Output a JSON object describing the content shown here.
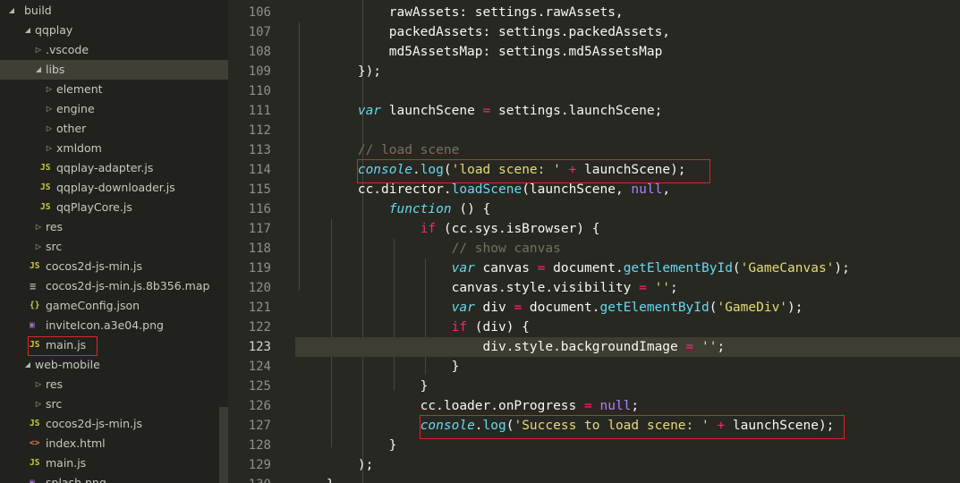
{
  "sidebar": {
    "items": [
      {
        "label": "build",
        "icon": "chevron-down",
        "type": "folder-open"
      },
      {
        "label": "qqplay",
        "icon": "chevron-down",
        "type": "folder-open"
      },
      {
        "label": ".vscode",
        "icon": "chevron-right",
        "type": "folder"
      },
      {
        "label": "libs",
        "icon": "chevron-down",
        "type": "folder-open"
      },
      {
        "label": "element",
        "icon": "chevron-right",
        "type": "folder"
      },
      {
        "label": "engine",
        "icon": "chevron-right",
        "type": "folder"
      },
      {
        "label": "other",
        "icon": "chevron-right",
        "type": "folder"
      },
      {
        "label": "xmldom",
        "icon": "chevron-right",
        "type": "folder"
      },
      {
        "label": "qqplay-adapter.js",
        "icon": "JS",
        "type": "js"
      },
      {
        "label": "qqplay-downloader.js",
        "icon": "JS",
        "type": "js"
      },
      {
        "label": "qqPlayCore.js",
        "icon": "JS",
        "type": "js"
      },
      {
        "label": "res",
        "icon": "chevron-right",
        "type": "folder"
      },
      {
        "label": "src",
        "icon": "chevron-right",
        "type": "folder"
      },
      {
        "label": "cocos2d-js-min.js",
        "icon": "JS",
        "type": "js"
      },
      {
        "label": "cocos2d-js-min.js.8b356.map",
        "icon": "≡",
        "type": "map"
      },
      {
        "label": "gameConfig.json",
        "icon": "{}",
        "type": "json"
      },
      {
        "label": "inviteIcon.a3e04.png",
        "icon": "▣",
        "type": "image"
      },
      {
        "label": "main.js",
        "icon": "JS",
        "type": "js"
      },
      {
        "label": "web-mobile",
        "icon": "chevron-down",
        "type": "folder-open"
      },
      {
        "label": "res",
        "icon": "chevron-right",
        "type": "folder"
      },
      {
        "label": "src",
        "icon": "chevron-right",
        "type": "folder"
      },
      {
        "label": "cocos2d-js-min.js",
        "icon": "JS",
        "type": "js"
      },
      {
        "label": "index.html",
        "icon": "<>",
        "type": "html"
      },
      {
        "label": "main.js",
        "icon": "JS",
        "type": "js"
      },
      {
        "label": "splash.png",
        "icon": "▣",
        "type": "image"
      }
    ]
  },
  "editor": {
    "active_line": 123,
    "lines": [
      {
        "n": "106",
        "code": [
          [
            "",
            "            rawAssets: settings.rawAssets,"
          ]
        ]
      },
      {
        "n": "107",
        "code": [
          [
            "",
            "            packedAssets: settings.packedAssets,"
          ]
        ]
      },
      {
        "n": "108",
        "code": [
          [
            "",
            "            md5AssetsMap: settings.md5AssetsMap"
          ]
        ]
      },
      {
        "n": "109",
        "code": [
          [
            "",
            "        });"
          ]
        ]
      },
      {
        "n": "110",
        "code": []
      },
      {
        "n": "111",
        "code": [
          [
            "",
            "        "
          ],
          [
            "var",
            "var"
          ],
          [
            "",
            " launchScene "
          ],
          [
            "op",
            "="
          ],
          [
            "",
            " settings.launchScene;"
          ]
        ]
      },
      {
        "n": "112",
        "code": []
      },
      {
        "n": "113",
        "code": [
          [
            "",
            "        "
          ],
          [
            "cmt",
            "// load scene"
          ]
        ]
      },
      {
        "n": "114",
        "code": [
          [
            "",
            "        "
          ],
          [
            "var",
            "console"
          ],
          [
            "",
            "."
          ],
          [
            "fn",
            "log"
          ],
          [
            "",
            "("
          ],
          [
            "str",
            "'load scene: '"
          ],
          [
            "",
            " "
          ],
          [
            "op",
            "+"
          ],
          [
            "",
            " launchScene);"
          ]
        ]
      },
      {
        "n": "115",
        "code": [
          [
            "",
            "        cc.director."
          ],
          [
            "fn",
            "loadScene"
          ],
          [
            "",
            "(launchScene, "
          ],
          [
            "null",
            "null"
          ],
          [
            "",
            ","
          ]
        ]
      },
      {
        "n": "116",
        "code": [
          [
            "",
            "            "
          ],
          [
            "func",
            "function"
          ],
          [
            "",
            " () {"
          ]
        ]
      },
      {
        "n": "117",
        "code": [
          [
            "",
            "                "
          ],
          [
            "kw",
            "if"
          ],
          [
            "",
            " (cc.sys.isBrowser) {"
          ]
        ]
      },
      {
        "n": "118",
        "code": [
          [
            "",
            "                    "
          ],
          [
            "cmt",
            "// show canvas"
          ]
        ]
      },
      {
        "n": "119",
        "code": [
          [
            "",
            "                    "
          ],
          [
            "var",
            "var"
          ],
          [
            "",
            " canvas "
          ],
          [
            "op",
            "="
          ],
          [
            "",
            " document."
          ],
          [
            "fn",
            "getElementById"
          ],
          [
            "",
            "("
          ],
          [
            "str",
            "'GameCanvas'"
          ],
          [
            "",
            ");"
          ]
        ]
      },
      {
        "n": "120",
        "code": [
          [
            "",
            "                    canvas.style.visibility "
          ],
          [
            "op",
            "="
          ],
          [
            "",
            " "
          ],
          [
            "str",
            "''"
          ],
          [
            "",
            ";"
          ]
        ]
      },
      {
        "n": "121",
        "code": [
          [
            "",
            "                    "
          ],
          [
            "var",
            "var"
          ],
          [
            "",
            " div "
          ],
          [
            "op",
            "="
          ],
          [
            "",
            " document."
          ],
          [
            "fn",
            "getElementById"
          ],
          [
            "",
            "("
          ],
          [
            "str",
            "'GameDiv'"
          ],
          [
            "",
            ");"
          ]
        ]
      },
      {
        "n": "122",
        "code": [
          [
            "",
            "                    "
          ],
          [
            "kw",
            "if"
          ],
          [
            "",
            " (div) {"
          ]
        ]
      },
      {
        "n": "123",
        "code": [
          [
            "",
            "                        div.style.backgroundImage "
          ],
          [
            "op",
            "="
          ],
          [
            "",
            " "
          ],
          [
            "str",
            "''"
          ],
          [
            "",
            ";"
          ]
        ]
      },
      {
        "n": "124",
        "code": [
          [
            "",
            "                    }"
          ]
        ]
      },
      {
        "n": "125",
        "code": [
          [
            "",
            "                }"
          ]
        ]
      },
      {
        "n": "126",
        "code": [
          [
            "",
            "                cc.loader.onProgress "
          ],
          [
            "op",
            "="
          ],
          [
            "",
            " "
          ],
          [
            "null",
            "null"
          ],
          [
            "",
            ";"
          ]
        ]
      },
      {
        "n": "127",
        "code": [
          [
            "",
            "                "
          ],
          [
            "var",
            "console"
          ],
          [
            "",
            "."
          ],
          [
            "fn",
            "log"
          ],
          [
            "",
            "("
          ],
          [
            "str",
            "'Success to load scene: '"
          ],
          [
            "",
            " "
          ],
          [
            "op",
            "+"
          ],
          [
            "",
            " launchScene);"
          ]
        ]
      },
      {
        "n": "128",
        "code": [
          [
            "",
            "            }"
          ]
        ]
      },
      {
        "n": "129",
        "code": [
          [
            "",
            "        );"
          ]
        ]
      },
      {
        "n": "130",
        "code": [
          [
            "",
            "    }"
          ]
        ]
      }
    ]
  },
  "colors": {
    "editor_bg": "#272822",
    "sidebar_bg": "#21221d",
    "annotation": "#e02424",
    "keyword": "#f92672",
    "string": "#e6db74",
    "function": "#66d9ef",
    "comment": "#75715e"
  }
}
